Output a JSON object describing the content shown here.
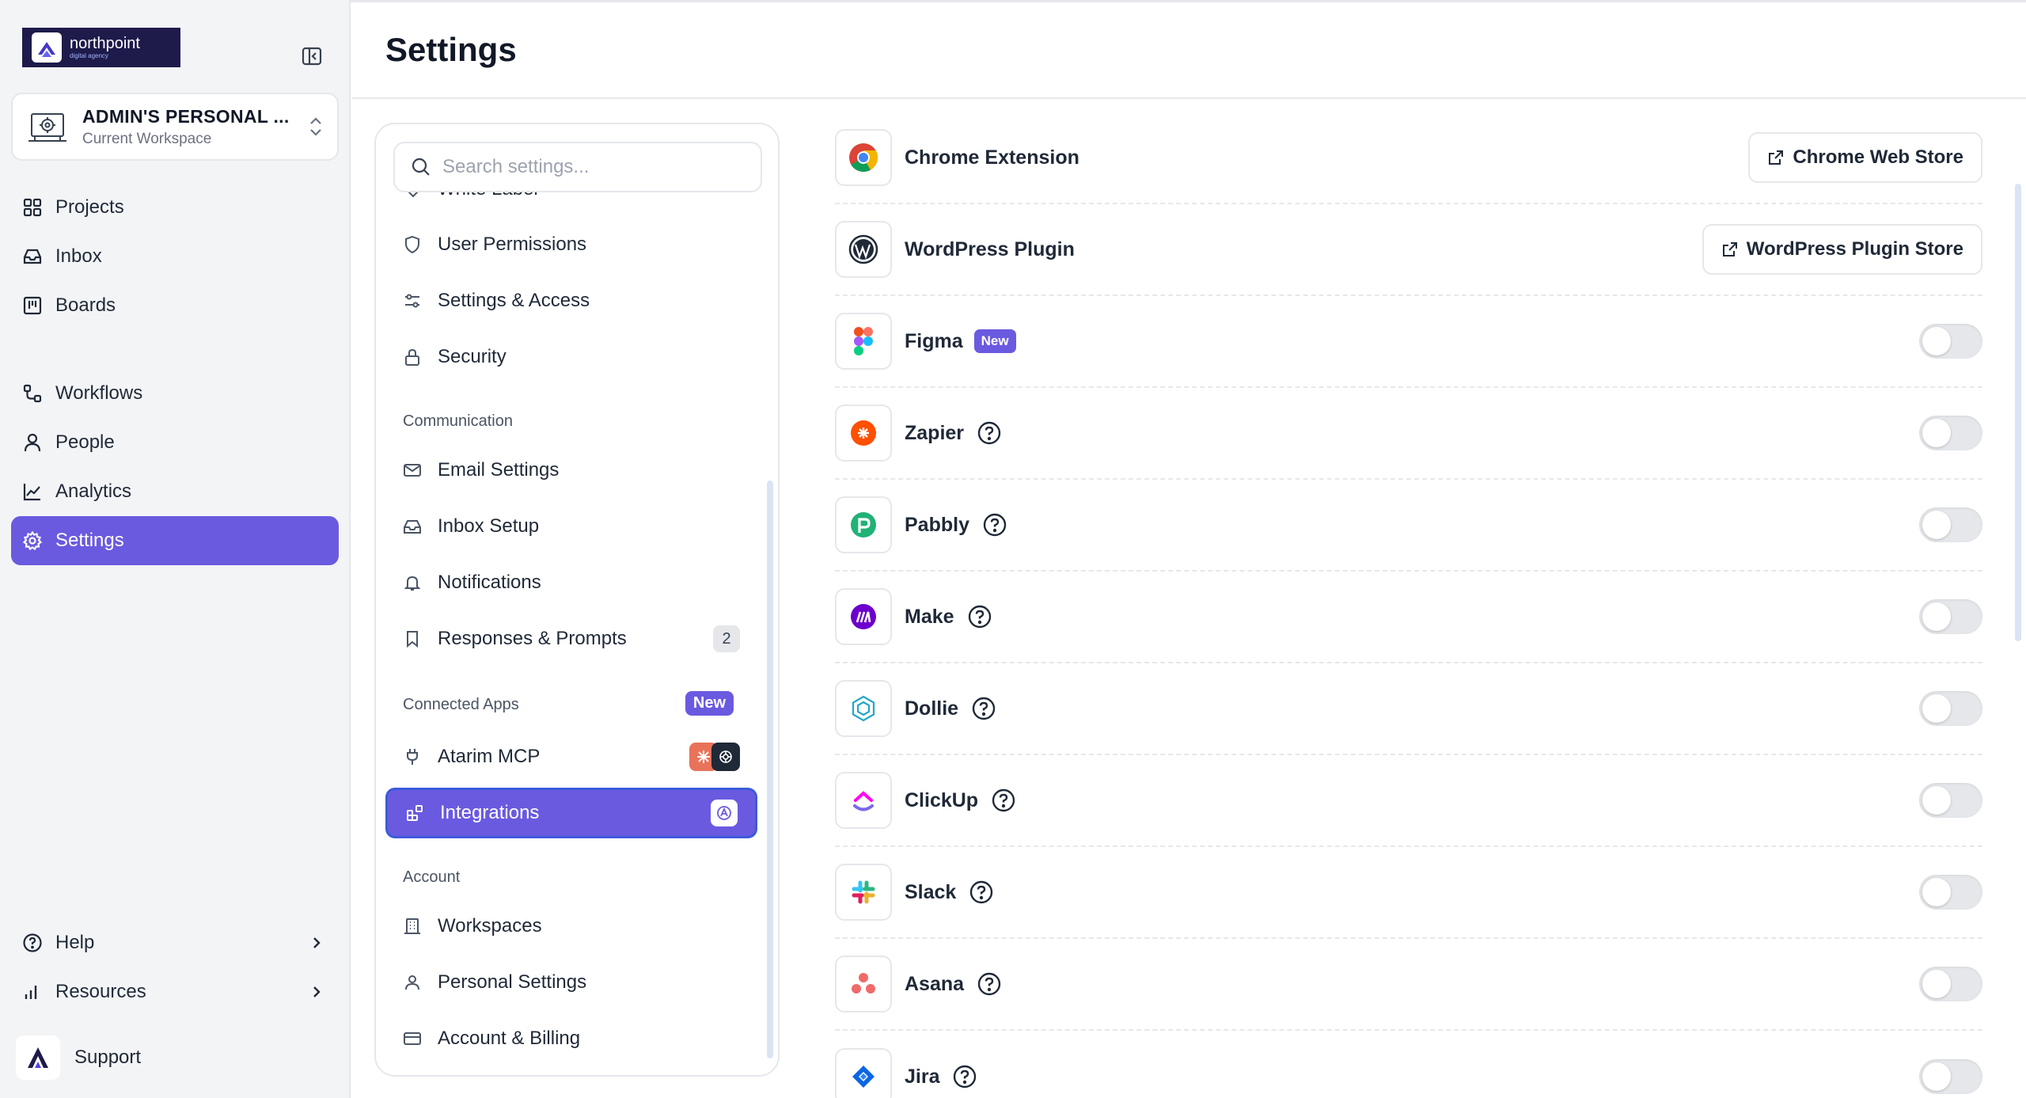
{
  "brand": {
    "name": "northpoint",
    "tagline": "digital agency"
  },
  "workspace": {
    "name": "ADMIN'S PERSONAL ...",
    "subtitle": "Current Workspace"
  },
  "nav": {
    "projects": "Projects",
    "inbox": "Inbox",
    "boards": "Boards",
    "workflows": "Workflows",
    "people": "People",
    "analytics": "Analytics",
    "settings": "Settings",
    "help": "Help",
    "resources": "Resources",
    "support": "Support"
  },
  "header": {
    "title": "Settings"
  },
  "search": {
    "placeholder": "Search settings..."
  },
  "menu": {
    "partial_item": "White Label",
    "user_permissions": "User Permissions",
    "settings_access": "Settings & Access",
    "security": "Security",
    "section_communication": "Communication",
    "email_settings": "Email Settings",
    "inbox_setup": "Inbox Setup",
    "notifications": "Notifications",
    "responses_prompts": "Responses & Prompts",
    "responses_prompts_count": "2",
    "section_connected_apps": "Connected Apps",
    "connected_apps_badge": "New",
    "atarim_mcp": "Atarim MCP",
    "integrations": "Integrations",
    "section_account": "Account",
    "workspaces": "Workspaces",
    "personal_settings": "Personal Settings",
    "account_billing": "Account & Billing"
  },
  "integrations": {
    "chrome": {
      "name": "Chrome Extension",
      "button": "Chrome Web Store"
    },
    "wordpress": {
      "name": "WordPress Plugin",
      "button": "WordPress Plugin Store"
    },
    "figma": {
      "name": "Figma",
      "badge": "New",
      "enabled": false
    },
    "zapier": {
      "name": "Zapier",
      "enabled": false
    },
    "pabbly": {
      "name": "Pabbly",
      "enabled": false
    },
    "make": {
      "name": "Make",
      "enabled": false
    },
    "dollie": {
      "name": "Dollie",
      "enabled": false
    },
    "clickup": {
      "name": "ClickUp",
      "enabled": false
    },
    "slack": {
      "name": "Slack",
      "enabled": false
    },
    "asana": {
      "name": "Asana",
      "enabled": false
    },
    "jira": {
      "name": "Jira",
      "enabled": false
    }
  },
  "colors": {
    "accent": "#6a5ae0",
    "focus_ring": "#3b5bdb",
    "sidebar_bg": "#f3f4f6"
  }
}
